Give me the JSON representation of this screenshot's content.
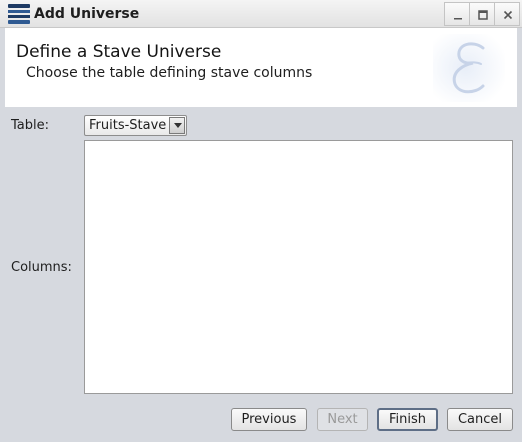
{
  "window": {
    "title": "Add Universe"
  },
  "header": {
    "title": "Define a Stave Universe",
    "subtitle": "Choose the table defining stave columns"
  },
  "form": {
    "table_label": "Table:",
    "table_value": "Fruits-Stave",
    "columns_label": "Columns:",
    "columns": []
  },
  "buttons": {
    "previous": "Previous",
    "next": "Next",
    "finish": "Finish",
    "cancel": "Cancel"
  },
  "colors": {
    "background": "#d6d9df",
    "banner": "#ffffff",
    "logo_accent": "#c7d3e8",
    "app_icon": "#1d3a63"
  },
  "icons": {
    "app": "universe-app-icon",
    "minimize": "minimize-icon",
    "maximize": "maximize-icon",
    "close": "close-icon",
    "logo": "script-e-logo-icon",
    "dropdown": "chevron-down-icon"
  }
}
